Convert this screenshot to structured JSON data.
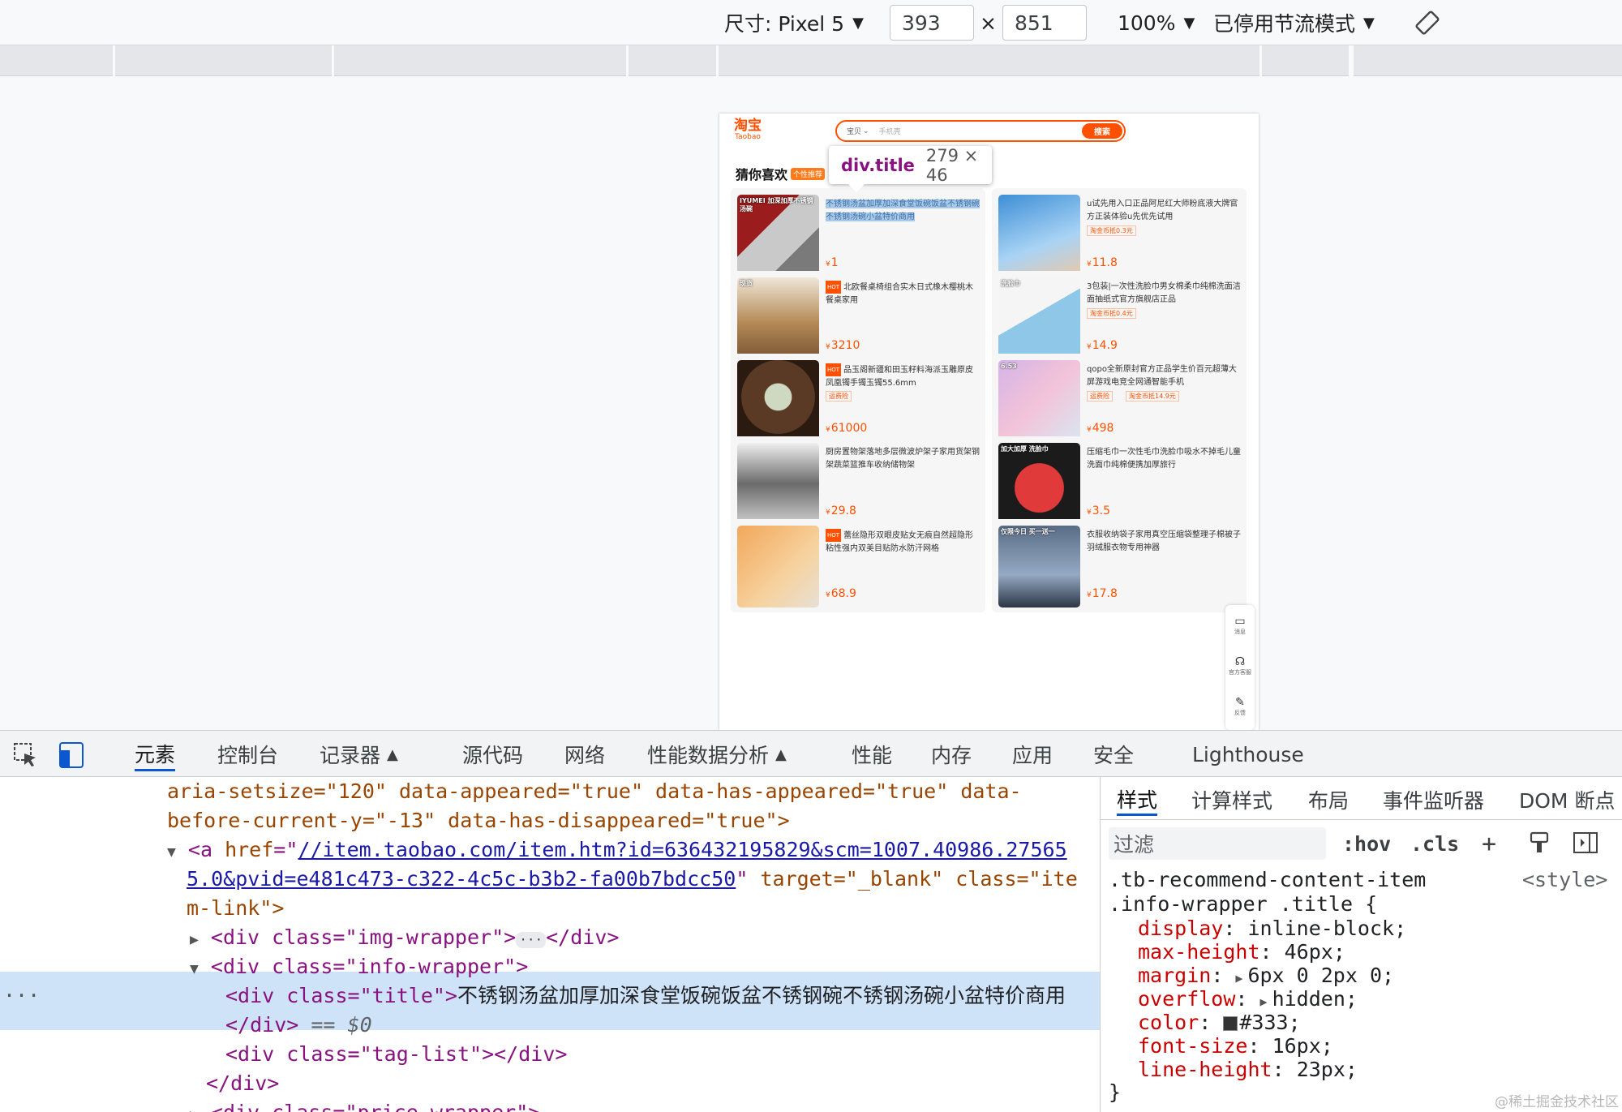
{
  "device_toolbar": {
    "device_label": "尺寸: Pixel 5",
    "width": "393",
    "times": "×",
    "height": "851",
    "zoom": "100%",
    "throttle": "已停用节流模式",
    "rotate_icon": "rotate-icon"
  },
  "page": {
    "logo": "淘宝",
    "logo_sub": "Taobao",
    "search_scope": "宝贝",
    "search_placeholder": "手机壳",
    "search_button": "搜索",
    "section_title": "猜你喜欢",
    "section_tag": "个性推荐",
    "products": [
      {
        "title": "不锈钢汤盆加厚加深食堂饭碗饭盆不锈钢碗不锈钢汤碗小盆特价商用",
        "price": "1",
        "badge": "",
        "tags": [],
        "thumb_text": "IYUMEI 加深加厚不锈钢汤碗"
      },
      {
        "title": "u试先用入口正品阿尼红大师粉底液大牌官方正装体验u先优先试用",
        "price": "11.8",
        "badge": "",
        "tags": [
          "淘金币抵0.3元"
        ],
        "thumb_text": ""
      },
      {
        "title": "北欧餐桌椅组合实木日式橡木樱桃木餐桌家用",
        "price": "3210",
        "badge": "HOT",
        "tags": [],
        "thumb_text": "现货"
      },
      {
        "title": "3包装|一次性洗脸巾男女棉柔巾纯棉洗面洁面抽纸式官方旗舰店正品",
        "price": "14.9",
        "badge": "",
        "tags": [
          "淘金币抵0.4元"
        ],
        "thumb_text": "洗脸巾"
      },
      {
        "title": "品玉阁新疆和田玉籽料海派玉雕原皮凤凰镯手镯玉镯55.6mm",
        "price": "61000",
        "badge": "HOT",
        "tags": [
          "运费险"
        ],
        "thumb_text": ""
      },
      {
        "title": "qopo全新原封官方正品学生价百元超薄大屏游戏电竞全网通智能手机",
        "price": "498",
        "badge": "",
        "tags": [
          "运费险",
          "淘金币抵14.9元"
        ],
        "thumb_text": "6.53"
      },
      {
        "title": "厨房置物架落地多层微波炉架子家用货架钢架蔬菜篮推车收纳储物架",
        "price": "29.8",
        "badge": "",
        "tags": [],
        "thumb_text": ""
      },
      {
        "title": "压缩毛巾一次性毛巾洗脸巾吸水不掉毛儿童洗面巾纯棉便携加厚旅行",
        "price": "3.5",
        "badge": "",
        "tags": [],
        "thumb_text": "加大加厚 洗脸巾"
      },
      {
        "title": "蕾丝隐形双眼皮贴女无痕自然超隐形粘性强内双美目贴防水防汗网格",
        "price": "68.9",
        "badge": "HOT",
        "tags": [],
        "thumb_text": ""
      },
      {
        "title": "衣服收纳袋子家用真空压缩袋整理子棉被子羽绒服衣物专用神器",
        "price": "17.8",
        "badge": "",
        "tags": [],
        "thumb_text": "仅限今日 买一送一"
      }
    ],
    "float_bar": [
      {
        "icon": "message-icon",
        "label": "消息"
      },
      {
        "icon": "headset-icon",
        "label": "官方客服"
      },
      {
        "icon": "feedback-icon",
        "label": "反馈"
      }
    ]
  },
  "tooltip": {
    "selector": "div.title",
    "size": "279 × 46"
  },
  "devtools": {
    "tabs": [
      "元素",
      "控制台",
      "记录器",
      "源代码",
      "网络",
      "性能数据分析",
      "性能",
      "内存",
      "应用",
      "安全",
      "Lighthouse"
    ],
    "active_tab": "元素",
    "dom_lines": {
      "l1a": "aria-setsize=\"120\" data-appeared=\"true\" data-has-appeared=\"true\" data-",
      "l1b": "before-current-y=\"-13\" data-has-disappeared=\"true\">",
      "a_open": "<a",
      "href_attr": "href",
      "href_1": "//item.taobao.com/item.htm?id=636432195829&scm=1007.40986.27565",
      "href_2": "5.0&pvid=e481c473-c322-4c5c-b3b2-fa00b7bdcc50",
      "target": "target=\"_blank\" class=\"ite",
      "target_2": "m-link\">",
      "img_wrapper": "<div class=\"img-wrapper\">",
      "img_close": "</div>",
      "info_wrapper": "<div class=\"info-wrapper\">",
      "title_open": "<div class=\"title\">",
      "title_text": "不锈钢汤盆加厚加深食堂饭碗饭盆不锈钢碗不锈钢汤碗小盆特价商用",
      "title_close": "</div>",
      "eq": "== $0",
      "tag_list": "<div class=\"tag-list\"></div>",
      "info_close": "</div>",
      "price_wrapper": "<div class=\"price-wrapper\">"
    },
    "style_tabs": [
      "样式",
      "计算样式",
      "布局",
      "事件监听器",
      "DOM 断点"
    ],
    "active_style_tab": "样式",
    "filter_placeholder": "过滤",
    "hov": ":hov",
    "cls": ".cls",
    "rule": {
      "selector_1": ".tb-recommend-content-item",
      "selector_2": ".info-wrapper .title {",
      "source": "<style>",
      "props": [
        {
          "name": "display",
          "value": "inline-block;"
        },
        {
          "name": "max-height",
          "value": "46px;"
        },
        {
          "name": "margin",
          "value": "6px 0 2px 0;"
        },
        {
          "name": "overflow",
          "value": "hidden;"
        },
        {
          "name": "color",
          "value": "#333;"
        },
        {
          "name": "font-size",
          "value": "16px;"
        },
        {
          "name": "line-height",
          "value": "23px;"
        }
      ],
      "close": "}"
    },
    "watermark": "@稀土掘金技术社区"
  }
}
